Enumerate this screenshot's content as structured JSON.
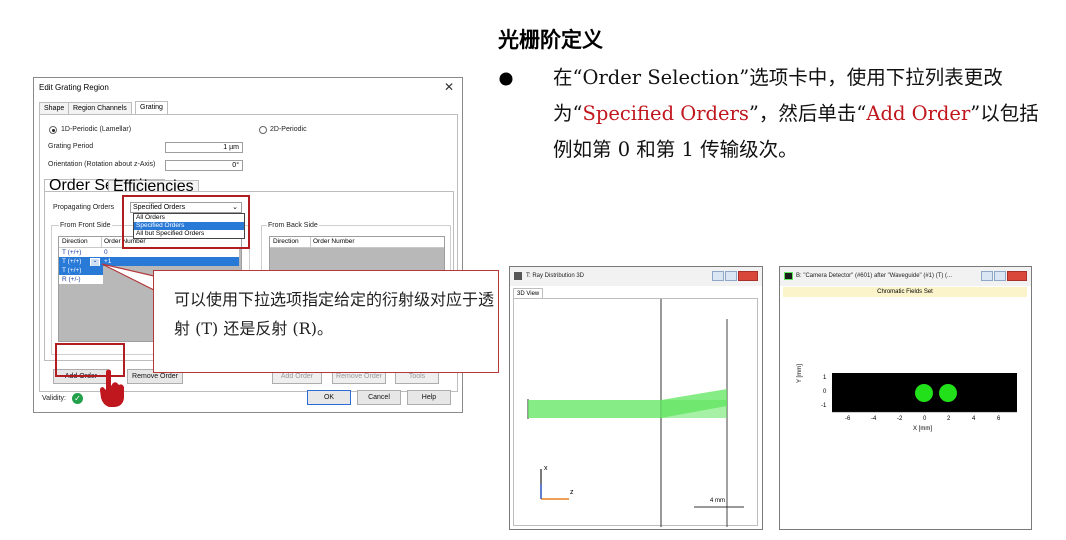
{
  "dialog": {
    "title": "Edit Grating Region",
    "close_glyph": "✕",
    "tabs": [
      "Shape",
      "Region Channels",
      "Grating"
    ],
    "radio_1d": "1D-Periodic (Lamellar)",
    "radio_2d": "2D-Periodic",
    "grating_period_label": "Grating Period",
    "grating_period_value": "1 µm",
    "orientation_label": "Orientation (Rotation about z-Axis)",
    "orientation_value": "0°",
    "subtabs": [
      "Order Selection",
      "Efficiencies"
    ],
    "propagating_label": "Propagating Orders",
    "propagating_value": "Specified Orders",
    "dropdown_options": [
      "All Orders",
      "Specified Orders",
      "All but Specified Orders"
    ],
    "front_side_label": "From Front Side",
    "back_side_label": "From Back Side",
    "table_headers": [
      "Direction",
      "Order Number"
    ],
    "front_rows": [
      {
        "direction": "T (+/+)",
        "order": "0"
      },
      {
        "direction": "T (+/+)",
        "order": "+1"
      },
      {
        "direction": "T (+/+)",
        "order": ""
      },
      {
        "direction": "R (+/-)",
        "order": ""
      }
    ],
    "add_order_label": "Add Order",
    "remove_order_label": "Remove Order",
    "tools_label": "Tools",
    "validity_label": "Validity:",
    "ok_label": "OK",
    "cancel_label": "Cancel",
    "help_label": "Help"
  },
  "callout": {
    "text": "可以使用下拉选项指定给定的衍射级对应于透射 (T) 还是反射 (R)。"
  },
  "heading": "光栅阶定义",
  "bullet": {
    "p1": "在“Order Selection”选项卡中，使用下拉列表更改为“",
    "h1": "Specified Orders",
    "p2": "”，然后单击“",
    "h2": "Add Order",
    "p3": "”以包括例如第 0 和第 1 传输级次。"
  },
  "ray_window": {
    "title": "T: Ray Distribution 3D",
    "tab": "3D View",
    "axis_x": "x",
    "axis_z": "z",
    "scale": "4 mm"
  },
  "camera_window": {
    "title": "B: \"Camera Detector\" (#601) after \"Waveguide\" (#1) (T) (...",
    "subtitle": "Chromatic Fields Set",
    "ylabel": "Y [mm]",
    "xlabel": "X [mm]",
    "xticks": [
      "-6",
      "-4",
      "-2",
      "0",
      "2",
      "4",
      "6"
    ],
    "yticks": [
      "1",
      "0",
      "-1"
    ]
  },
  "colors": {
    "highlight_red": "#b01e22",
    "text_red": "#c0161d",
    "selection_blue": "#2979d7",
    "ray_green": "#5ee65e"
  }
}
